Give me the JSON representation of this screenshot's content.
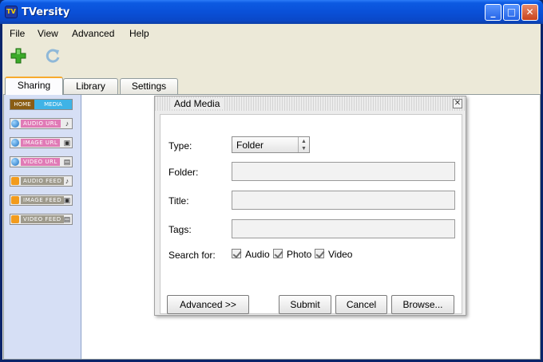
{
  "window": {
    "title": "TVersity",
    "icon": "tv-logo-icon"
  },
  "menu": [
    "File",
    "View",
    "Advanced",
    "Help"
  ],
  "toolbar": {
    "add_icon": "green-plus-icon",
    "refresh_icon": "refresh-icon"
  },
  "tabs": [
    {
      "label": "Sharing",
      "active": true
    },
    {
      "label": "Library",
      "active": false
    },
    {
      "label": "Settings",
      "active": false
    }
  ],
  "sidebar": {
    "home": "HOME",
    "media": "MEDIA",
    "items": [
      {
        "label": "AUDIO URL",
        "tag_color": "#e07bb6",
        "source": "globe-icon",
        "kind": "music-note-icon"
      },
      {
        "label": "IMAGE URL",
        "tag_color": "#e07bb6",
        "source": "globe-icon",
        "kind": "camera-icon"
      },
      {
        "label": "VIDEO URL",
        "tag_color": "#e07bb6",
        "source": "globe-icon",
        "kind": "film-icon"
      },
      {
        "label": "AUDIO FEED",
        "tag_color": "#9e9a8c",
        "source": "rss-feed-icon",
        "kind": "music-note-icon"
      },
      {
        "label": "IMAGE FEED",
        "tag_color": "#9e9a8c",
        "source": "rss-feed-icon",
        "kind": "camera-icon"
      },
      {
        "label": "VIDEO FEED",
        "tag_color": "#9e9a8c",
        "source": "rss-feed-icon",
        "kind": "film-icon"
      }
    ]
  },
  "dialog": {
    "title": "Add Media",
    "type_label": "Type:",
    "type_value": "Folder",
    "folder_label": "Folder:",
    "folder_value": "",
    "title_label": "Title:",
    "title_value": "",
    "tags_label": "Tags:",
    "tags_value": "",
    "search_label": "Search for:",
    "search_options": [
      {
        "label": "Audio",
        "checked": true
      },
      {
        "label": "Photo",
        "checked": true
      },
      {
        "label": "Video",
        "checked": true
      }
    ],
    "buttons": {
      "advanced": "Advanced >>",
      "submit": "Submit",
      "cancel": "Cancel",
      "browse": "Browse..."
    }
  },
  "colors": {
    "title_bar": "#0a50d8",
    "sidebar_bg": "#d6dff5",
    "active_tab_accent": "#f7ab2e"
  }
}
